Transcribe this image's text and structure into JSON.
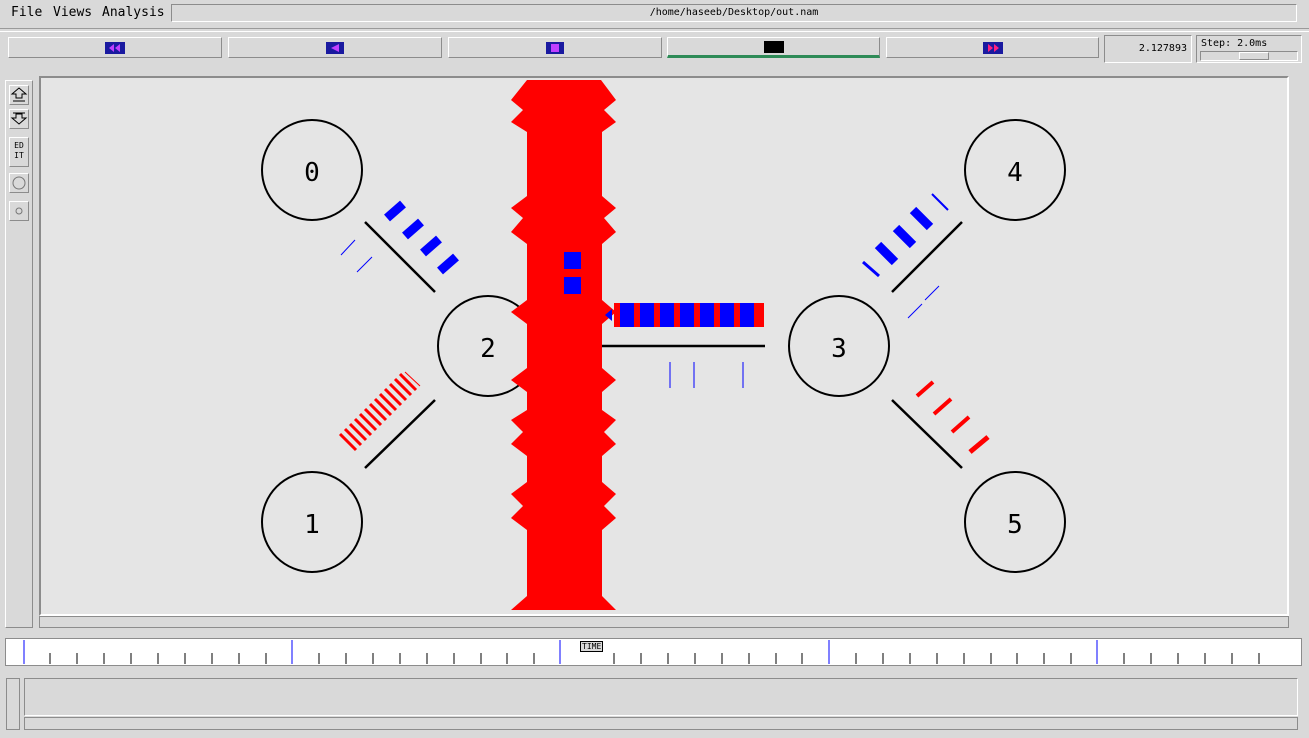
{
  "menu": {
    "file": "File",
    "views": "Views",
    "analysis": "Analysis"
  },
  "file_path": "/home/haseeb/Desktop/out.nam",
  "controls": {
    "rewind_icon": "fast-rewind-icon",
    "back_icon": "play-backward-icon",
    "stop_icon": "stop-icon",
    "pause_icon": "pause-icon",
    "forward_icon": "fast-forward-icon",
    "active_button": "pause"
  },
  "time_readout": "2.127893",
  "step": {
    "label": "Step: 2.0ms"
  },
  "toolbar": {
    "zoom_in_icon": "zoom-in-icon",
    "zoom_out_icon": "zoom-out-icon",
    "edit_label": "ED IT",
    "circle_icon": "circle-icon",
    "small_circle_icon": "small-circle-icon"
  },
  "nodes": [
    {
      "id": "0"
    },
    {
      "id": "1"
    },
    {
      "id": "2"
    },
    {
      "id": "3"
    },
    {
      "id": "4"
    },
    {
      "id": "5"
    }
  ],
  "timeline": {
    "label": "TIME"
  },
  "colors": {
    "background": "#d9d9d9",
    "canvas": "#e5e5e5",
    "flow_red": "#ff0000",
    "flow_blue": "#0000ff",
    "active_green": "#2e8b57"
  }
}
